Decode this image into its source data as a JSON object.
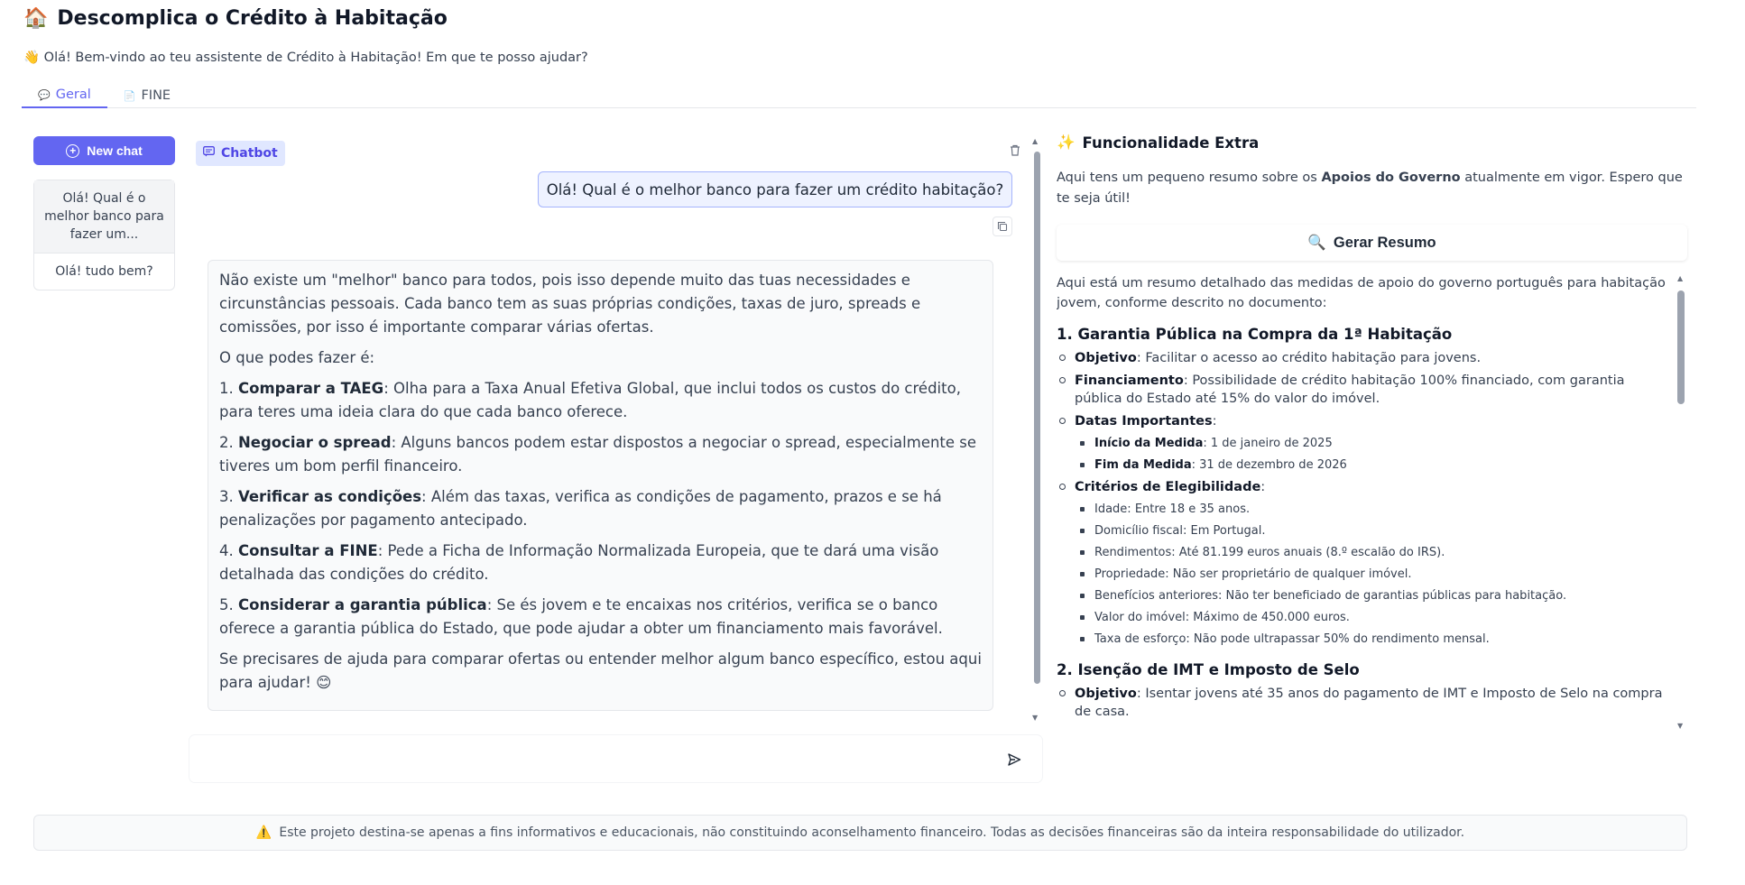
{
  "app": {
    "title_icon": "🏠",
    "title": "Descomplica o Crédito à Habitação",
    "subtitle_icon": "👋",
    "subtitle": "Olá! Bem-vindo ao teu assistente de Crédito à Habitação! Em que te posso ajudar?"
  },
  "tabs": [
    {
      "icon": "💬",
      "label": "Geral",
      "active": true
    },
    {
      "icon": "📄",
      "label": "FINE",
      "active": false
    }
  ],
  "sidebar": {
    "new_chat_label": "New chat",
    "history": [
      {
        "label": "Olá! Qual é o melhor banco para fazer um..."
      },
      {
        "label": "Olá! tudo bem?"
      }
    ]
  },
  "chat": {
    "label": "Chatbot",
    "user_message": "Olá! Qual é o melhor banco para fazer um crédito habitação?",
    "bot": {
      "intro": "Não existe um \"melhor\" banco para todos, pois isso depende muito das tuas necessidades e circunstâncias pessoais. Cada banco tem as suas próprias condições, taxas de juro, spreads e comissões, por isso é importante comparar várias ofertas.",
      "lead": "O que podes fazer é:",
      "items": [
        {
          "num": "1.",
          "title": "Comparar a TAEG",
          "text": ": Olha para a Taxa Anual Efetiva Global, que inclui todos os custos do crédito, para teres uma ideia clara do que cada banco oferece."
        },
        {
          "num": "2.",
          "title": "Negociar o spread",
          "text": ": Alguns bancos podem estar dispostos a negociar o spread, especialmente se tiveres um bom perfil financeiro."
        },
        {
          "num": "3.",
          "title": "Verificar as condições",
          "text": ": Além das taxas, verifica as condições de pagamento, prazos e se há penalizações por pagamento antecipado."
        },
        {
          "num": "4.",
          "title": "Consultar a FINE",
          "text": ": Pede a Ficha de Informação Normalizada Europeia, que te dará uma visão detalhada das condições do crédito."
        },
        {
          "num": "5.",
          "title": "Considerar a garantia pública",
          "text": ": Se és jovem e te encaixas nos critérios, verifica se o banco oferece a garantia pública do Estado, que pode ajudar a obter um financiamento mais favorável."
        }
      ],
      "outro": "Se precisares de ajuda para comparar ofertas ou entender melhor algum banco específico, estou aqui para ajudar! 😊"
    },
    "input_placeholder": ""
  },
  "extra": {
    "title_icon": "✨",
    "title": "Funcionalidade Extra",
    "desc_pre": "Aqui tens um pequeno resumo sobre os ",
    "desc_bold": "Apoios do Governo",
    "desc_post": " atualmente em vigor. Espero que te seja útil!",
    "button_icon": "🔍",
    "button_label": "Gerar Resumo",
    "summary": {
      "intro": "Aqui está um resumo detalhado das medidas de apoio do governo português para habitação jovem, conforme descrito no documento:",
      "s1_title": "1. Garantia Pública na Compra da 1ª Habitação",
      "s1_obj_label": "Objetivo",
      "s1_obj_text": ": Facilitar o acesso ao crédito habitação para jovens.",
      "s1_fin_label": "Financiamento",
      "s1_fin_text": ": Possibilidade de crédito habitação 100% financiado, com garantia pública do Estado até 15% do valor do imóvel.",
      "s1_dates_label": "Datas Importantes",
      "s1_dates_colon": ":",
      "s1_start_label": "Início da Medida",
      "s1_start_text": ": 1 de janeiro de 2025",
      "s1_end_label": "Fim da Medida",
      "s1_end_text": ": 31 de dezembro de 2026",
      "s1_crit_label": "Critérios de Elegibilidade",
      "s1_crit_colon": ":",
      "s1_criteria": [
        "Idade: Entre 18 e 35 anos.",
        "Domicílio fiscal: Em Portugal.",
        "Rendimentos: Até 81.199 euros anuais (8.º escalão do IRS).",
        "Propriedade: Não ser proprietário de qualquer imóvel.",
        "Benefícios anteriores: Não ter beneficiado de garantias públicas para habitação.",
        "Valor do imóvel: Máximo de 450.000 euros.",
        "Taxa de esforço: Não pode ultrapassar 50% do rendimento mensal."
      ],
      "s2_title": "2. Isenção de IMT e Imposto de Selo",
      "s2_obj_label": "Objetivo",
      "s2_obj_text": ": Isentar jovens até 35 anos do pagamento de IMT e Imposto de Selo na compra de casa."
    }
  },
  "disclaimer": {
    "icon": "⚠️",
    "text": "Este projeto destina-se apenas a fins informativos e educacionais, não constituindo aconselhamento financeiro. Todas as decisões financeiras são da inteira responsabilidade do utilizador."
  }
}
